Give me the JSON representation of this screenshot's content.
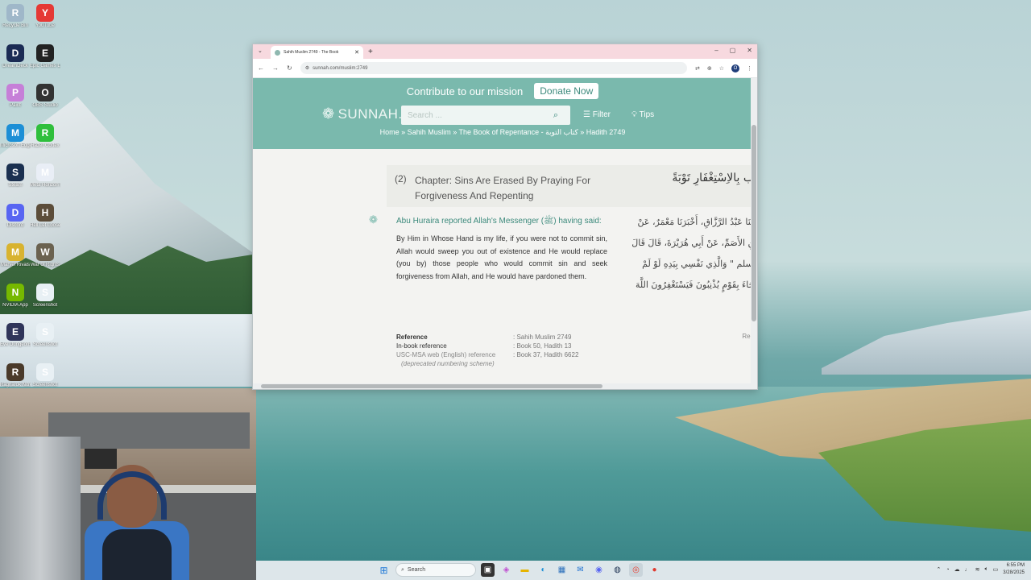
{
  "desktop": {
    "icons": [
      {
        "label": "Recycle Bin",
        "icon": "recycle-bin-icon",
        "color": "#9fb7c9"
      },
      {
        "label": "YouTube",
        "icon": "youtube-icon",
        "color": "#e53935"
      },
      {
        "label": "DreamDeck",
        "icon": "grid-app-icon",
        "color": "#1b2b54"
      },
      {
        "label": "Epic Games Launcher",
        "icon": "epic-games-icon",
        "color": "#222"
      },
      {
        "label": "Paint",
        "icon": "paint-icon",
        "color": "#c67fd8"
      },
      {
        "label": "OBS Studio",
        "icon": "obs-icon",
        "color": "#333"
      },
      {
        "label": "Microsoft Edge",
        "icon": "edge-icon",
        "color": "#1c8fd6"
      },
      {
        "label": "Razer Cortex",
        "icon": "razer-icon",
        "color": "#2fbf3c"
      },
      {
        "label": "Steam",
        "icon": "steam-icon",
        "color": "#1b3050"
      },
      {
        "label": "Meta Horizon Link",
        "icon": "meta-icon",
        "color": "#e9eef6"
      },
      {
        "label": "Discord",
        "icon": "discord-icon",
        "color": "#5865f2"
      },
      {
        "label": "Hell Let Loose",
        "icon": "game-icon",
        "color": "#5c4d3a"
      },
      {
        "label": "Marvel Rivals",
        "icon": "marvel-rivals-icon",
        "color": "#d8b330"
      },
      {
        "label": "War of Rights",
        "icon": "war-of-rights-icon",
        "color": "#6b6250"
      },
      {
        "label": "NVIDIA App",
        "icon": "nvidia-icon",
        "color": "#76b900"
      },
      {
        "label": "Screenshot",
        "icon": "screenshot-file-icon",
        "color": "#e8f0f4"
      },
      {
        "label": "Eve Dungeons",
        "icon": "dragon-game-icon",
        "color": "#30355a"
      },
      {
        "label": "Screenshot",
        "icon": "screenshot-file-icon",
        "color": "#e8f0f4"
      },
      {
        "label": "Ragnarok Nitro",
        "icon": "game-icon",
        "color": "#4a3a2a"
      },
      {
        "label": "Screenshot",
        "icon": "screenshot-file-icon",
        "color": "#e8f0f4"
      }
    ]
  },
  "browser": {
    "tab_title": "Sahih Muslim 2749 - The Book",
    "url": "sunnah.com/muslim:2749",
    "profile_initial": "O"
  },
  "site": {
    "banner_text": "Contribute to our mission",
    "donate_label": "Donate Now",
    "logo_text": "SUNNAH.C",
    "search_placeholder": "Search ...",
    "filter_label": "Filter",
    "tips_label": "Tips",
    "breadcrumb": "Home » Sahih Muslim » The Book of Repentance - كتاب التوبة » Hadith 2749",
    "accent": "#7ab9ad"
  },
  "chapter": {
    "number": "(2)",
    "title": "Chapter: Sins Are Erased By Praying For Forgiveness And Repenting",
    "arabic": "ب بِالاِسْتِغْفَارِ تَوْبَةً"
  },
  "hadith": {
    "narrator": "Abu Huraira reported Allah's Messenger (ﷺ) having said:",
    "text": "By Him in Whose Hand is my life, if you were not to commit sin, Allah would sweep you out of existence and He would replace (you by) those people who would commit sin and seek forgiveness from Allah, and He would have pardoned them.",
    "arabic_lines": [
      "دَّثَنَا عَبْدُ الرَّزَّاقِ، أَخْبَرَنَا مَعْمَرٌ، عَنْ",
      "بْنِ الأَصَمِّ، عَنْ أَبِي هُرَيْرَةَ، قَالَ قَالَ",
      "وسلم \" وَالَّذِي نَفْسِي بِيَدِهِ لَوْ لَمْ",
      "لَجَاءَ بِقَوْمٍ يُذْنِبُونَ فَيَسْتَغْفِرُونَ اللَّهَ"
    ],
    "reference": {
      "ref_label": "Reference",
      "ref_value": ": Sahih Muslim 2749",
      "inbook_label": "In-book reference",
      "inbook_value": ": Book 50, Hadith 13",
      "usc_label": "USC-MSA web (English) reference",
      "usc_value": ": Book 37, Hadith 6622",
      "deprecated": "(deprecated numbering scheme)"
    },
    "report_label": "Rep"
  },
  "taskbar": {
    "search_label": "Search",
    "time": "6:55 PM",
    "date": "3/28/2025"
  }
}
